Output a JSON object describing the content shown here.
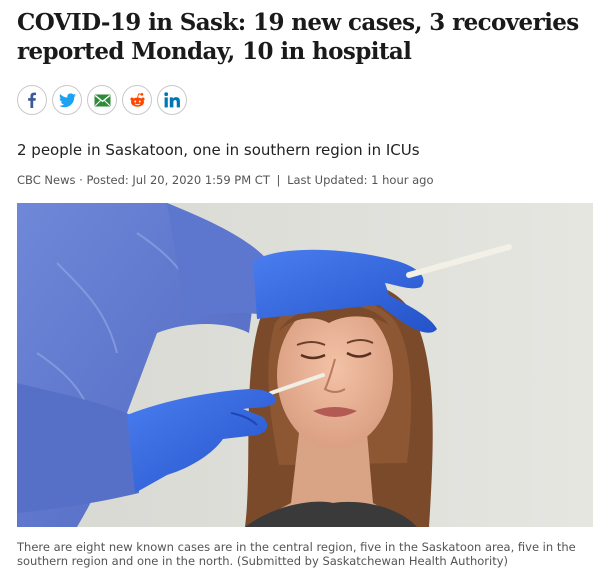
{
  "article": {
    "headline": "COVID-19 in Sask: 19 new cases, 3 recoveries reported Monday, 10 in hospital",
    "deck": "2 people in Saskatoon, one in southern region in ICUs",
    "byline": {
      "source": "CBC News",
      "dot": "·",
      "posted": "Posted: Jul 20, 2020 1:59 PM CT",
      "divider": "|",
      "updated": "Last Updated: 1 hour ago"
    },
    "photo": {
      "alt": "Health worker in blue gloves and gown swabbing a woman's nose"
    },
    "caption": "There are eight new known cases are in the central region, five in the Saskatoon area, five in the southern region and one in the north. (Submitted by Saskatchewan Health Authority)"
  },
  "share": {
    "buttons": [
      {
        "icon": "facebook-icon",
        "color": "#3b5998"
      },
      {
        "icon": "twitter-icon",
        "color": "#1da1f2"
      },
      {
        "icon": "email-icon",
        "color": "#2e8b3a"
      },
      {
        "icon": "reddit-icon",
        "color": "#ff4500"
      },
      {
        "icon": "linkedin-icon",
        "color": "#0077b5"
      }
    ]
  }
}
